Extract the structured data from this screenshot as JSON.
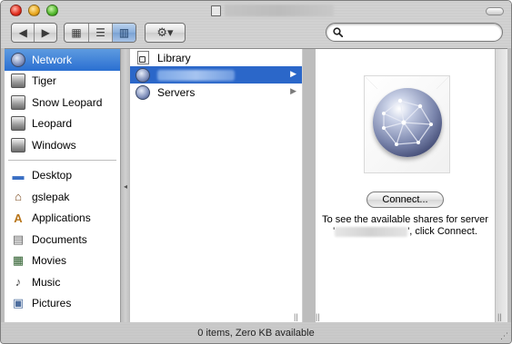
{
  "window": {
    "title_icon": "volume-icon"
  },
  "toolbar": {
    "nav": [
      {
        "icon": "back-icon",
        "glyph": "◀"
      },
      {
        "icon": "forward-icon",
        "glyph": "▶"
      }
    ],
    "views": [
      {
        "icon": "icon-view-icon",
        "glyph": "▦",
        "active": false
      },
      {
        "icon": "list-view-icon",
        "glyph": "☰",
        "active": false
      },
      {
        "icon": "column-view-icon",
        "glyph": "▥",
        "active": true
      }
    ],
    "action": {
      "icon": "gear-icon",
      "glyph": "⚙▾"
    },
    "search": {
      "value": "",
      "placeholder": ""
    }
  },
  "sidebar": {
    "devices": [
      {
        "label": "Network",
        "icon": "network-globe-icon",
        "selected": true
      },
      {
        "label": "Tiger",
        "icon": "hard-disk-icon"
      },
      {
        "label": "Snow Leopard",
        "icon": "hard-disk-icon"
      },
      {
        "label": "Leopard",
        "icon": "hard-disk-icon"
      },
      {
        "label": "Windows",
        "icon": "hard-disk-icon"
      }
    ],
    "places": [
      {
        "label": "Desktop",
        "icon": "desktop-icon",
        "glyph": "▬",
        "color": "#3a6fc4"
      },
      {
        "label": "gslepak",
        "icon": "home-icon",
        "glyph": "⌂",
        "color": "#7a4a1e"
      },
      {
        "label": "Applications",
        "icon": "applications-icon",
        "glyph": "A",
        "color": "#b8751a"
      },
      {
        "label": "Documents",
        "icon": "documents-icon",
        "glyph": "▤",
        "color": "#666666"
      },
      {
        "label": "Movies",
        "icon": "movies-icon",
        "glyph": "▦",
        "color": "#2d5e2d"
      },
      {
        "label": "Music",
        "icon": "music-icon",
        "glyph": "♪",
        "color": "#444444"
      },
      {
        "label": "Pictures",
        "icon": "pictures-icon",
        "glyph": "▣",
        "color": "#4f6f9f"
      }
    ]
  },
  "column1": {
    "items": [
      {
        "label": "Library",
        "icon": "alias-document-icon",
        "arrow": false,
        "selected": false
      },
      {
        "label": "",
        "icon": "alias-network-icon",
        "arrow": true,
        "selected": true
      },
      {
        "label": "Servers",
        "icon": "alias-network-icon",
        "arrow": true,
        "selected": false
      }
    ]
  },
  "preview": {
    "icon": "network-globe-large-icon",
    "connect_label": "Connect...",
    "text_before": "To see the available shares for server '",
    "text_after": "', click Connect."
  },
  "status": {
    "text": "0 items, Zero KB available"
  }
}
